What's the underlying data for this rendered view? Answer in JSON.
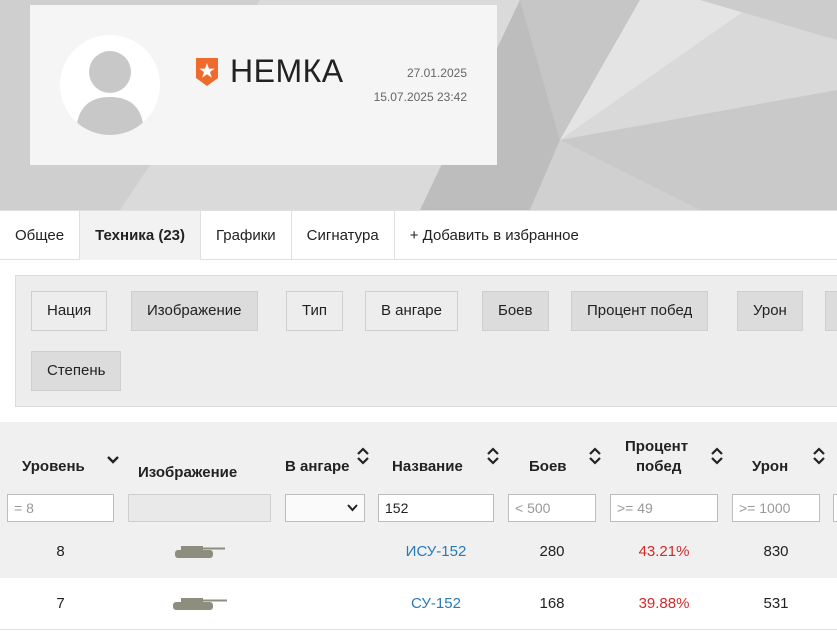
{
  "profile": {
    "nickname": "НЕМКА",
    "date_registered": "27.01.2025",
    "date_last_battle": "15.07.2025 23:42",
    "avatar_icon": "user-avatar-icon",
    "rank_icon": "clan-rank-star-icon",
    "rank_color": "#ef6a2d"
  },
  "tabs": [
    {
      "label": "Общее"
    },
    {
      "label": "Техника (23)"
    },
    {
      "label": "Графики"
    },
    {
      "label": "Сигнатура"
    },
    {
      "label": "+ Добавить в избранное"
    }
  ],
  "column_toggles": [
    {
      "label": "Нация",
      "on": false
    },
    {
      "label": "Изображение",
      "on": true
    },
    {
      "label": "Тип",
      "on": false
    },
    {
      "label": "В ангаре",
      "on": false
    },
    {
      "label": "Боев",
      "on": true
    },
    {
      "label": "Процент побед",
      "on": true
    },
    {
      "label": "Урон",
      "on": true
    },
    {
      "label": "Степень",
      "on": true
    }
  ],
  "table": {
    "headers": {
      "level": "Уровень",
      "image": "Изображение",
      "in_hangar": "В ангаре",
      "name": "Название",
      "battles": "Боев",
      "winrate_line1": "Процент",
      "winrate_line2": "побед",
      "damage": "Урон"
    },
    "filters": {
      "level": "= 8",
      "name_value": "152",
      "battles": "< 500",
      "winrate": ">= 49",
      "damage": ">= 1000"
    },
    "rows": [
      {
        "level": "8",
        "name": "ИСУ-152",
        "battles": "280",
        "winrate": "43.21%",
        "damage": "830"
      },
      {
        "level": "7",
        "name": "СУ-152",
        "battles": "168",
        "winrate": "39.88%",
        "damage": "531"
      }
    ]
  },
  "colors": {
    "link": "#2a7ab8",
    "bad_winrate": "#d12a2a",
    "tank_silhouette": "#8e8e7e"
  }
}
